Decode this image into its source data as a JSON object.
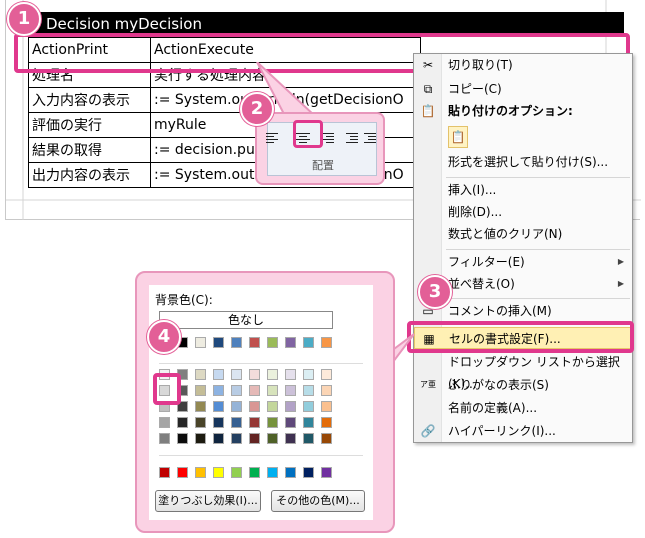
{
  "sheet": {
    "title": "Decision myDecision",
    "rows": [
      [
        "ActionPrint",
        "ActionExecute"
      ],
      [
        "処理名",
        "実行する処理内容"
      ],
      [
        "入力内容の表示",
        ":= System.out.println(getDecisionO"
      ],
      [
        "評価の実行",
        "myRule"
      ],
      [
        "結果の取得",
        ":= decision.putResult"
      ],
      [
        "出力内容の表示",
        ":= System.out.println(getDecisionO"
      ]
    ]
  },
  "alignment": {
    "caption": "配置"
  },
  "context_menu": {
    "cut": "切り取り(T)",
    "copy": "コピー(C)",
    "paste_options_header": "貼り付けのオプション:",
    "paste_special": "形式を選択して貼り付け(S)...",
    "insert": "挿入(I)...",
    "delete": "削除(D)...",
    "clear_contents": "数式と値のクリア(N)",
    "filter": "フィルター(E)",
    "sort": "並べ替え(O)",
    "insert_comment": "コメントの挿入(M)",
    "format_cells": "セルの書式設定(F)...",
    "pick_from_list": "ドロップダウン リストから選択(K)...",
    "show_phonetic": "ふりがなの表示(S)",
    "define_name": "名前の定義(A)...",
    "hyperlink": "ハイパーリンク(I)...",
    "phonetic_icon": "ア亜"
  },
  "palette": {
    "label": "背景色(C):",
    "no_color": "色なし",
    "fill_effects": "塗りつぶし効果(I)...",
    "more_colors": "その他の色(M)...",
    "colors": {
      "row1": [
        "#ffffff",
        "#000000",
        "#eeece1",
        "#1f497d",
        "#4f81bd",
        "#c0504d",
        "#9bbb59",
        "#8064a2",
        "#4bacc6",
        "#f79646"
      ],
      "row2": [
        "#f2f2f2",
        "#7f7f7f",
        "#ddd9c3",
        "#c6d9f0",
        "#dbe5f1",
        "#f2dcdb",
        "#ebf1dd",
        "#e5e0ec",
        "#dbeef3",
        "#fdeada"
      ],
      "row3": [
        "#d8d8d8",
        "#595959",
        "#c4bd97",
        "#8db3e2",
        "#b8cce4",
        "#e5b9b7",
        "#d7e3bc",
        "#ccc1d9",
        "#b7dde8",
        "#fbd5b5"
      ],
      "row4": [
        "#bfbfbf",
        "#3f3f3f",
        "#938953",
        "#548dd4",
        "#95b3d7",
        "#d99694",
        "#c3d69b",
        "#b2a2c7",
        "#92cddc",
        "#fac08f"
      ],
      "row5": [
        "#a5a5a5",
        "#262626",
        "#494429",
        "#17365d",
        "#366092",
        "#953734",
        "#76923c",
        "#5f497a",
        "#31859b",
        "#e36c09"
      ],
      "row6": [
        "#7f7f7f",
        "#0c0c0c",
        "#1d1b10",
        "#0f243e",
        "#244061",
        "#632423",
        "#4f6128",
        "#3f3151",
        "#205867",
        "#974806"
      ],
      "standard": [
        "#c00000",
        "#ff0000",
        "#ffc000",
        "#ffff00",
        "#92d050",
        "#00b050",
        "#00b0f0",
        "#0070c0",
        "#002060",
        "#7030a0"
      ]
    }
  },
  "badges": [
    "1",
    "2",
    "3",
    "4"
  ],
  "accent": "#e0388d"
}
